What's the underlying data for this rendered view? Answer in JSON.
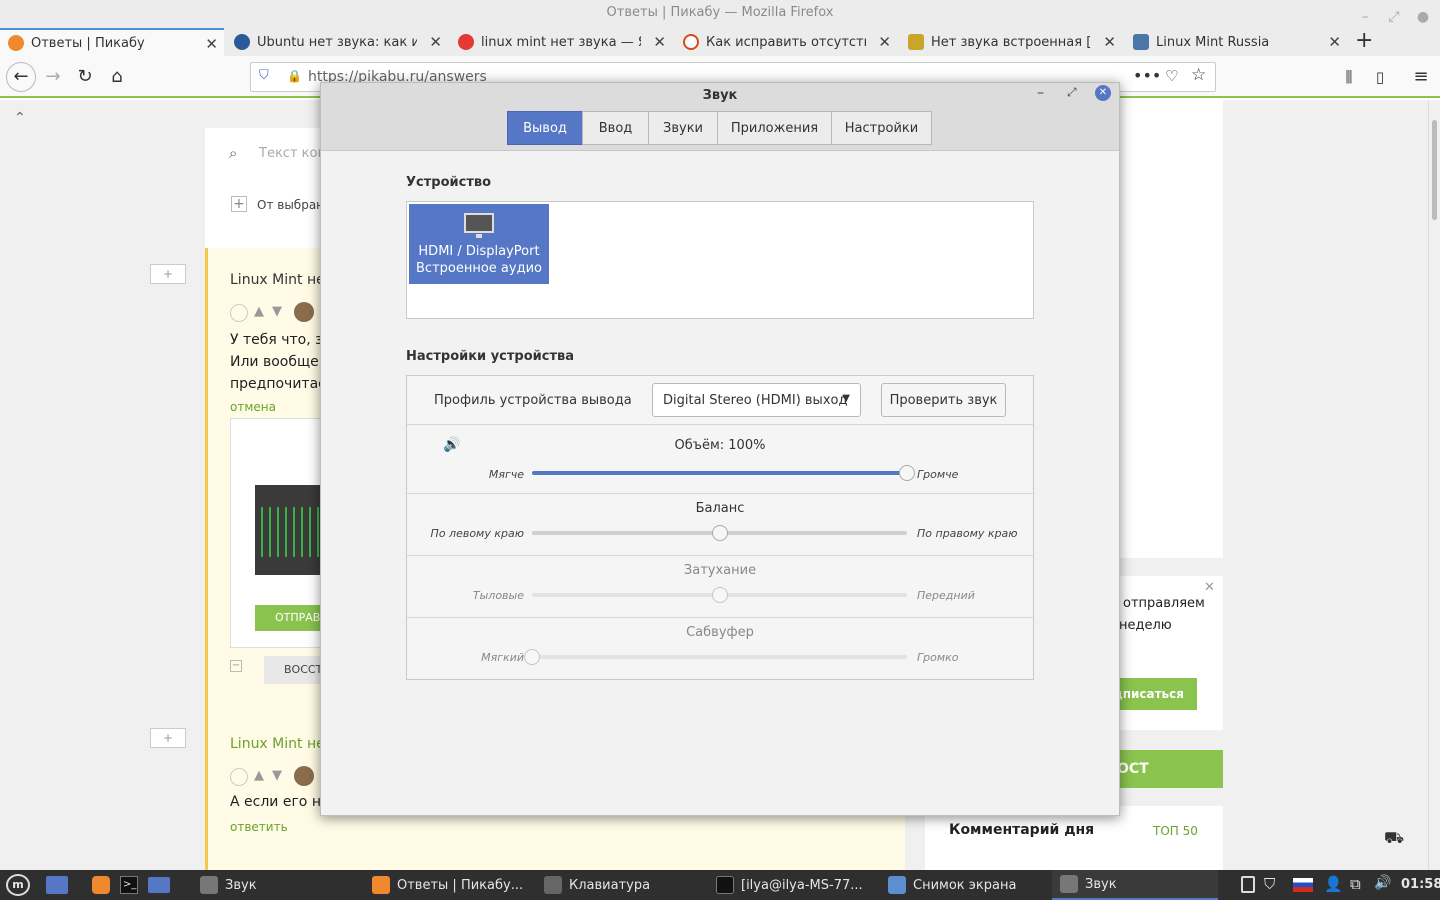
{
  "firefox": {
    "window_title": "Ответы | Пикабу — Mozilla Firefox",
    "tabs": [
      {
        "label": "Ответы | Пикабу",
        "icon": "pikabu-favicon",
        "active": true
      },
      {
        "label": "Ubuntu нет звука: как испр",
        "icon": "wordpress-favicon"
      },
      {
        "label": "linux mint нет звука — Янд",
        "icon": "yandex-favicon"
      },
      {
        "label": "Как исправить отсутствие",
        "icon": "ubuntu-favicon"
      },
      {
        "label": "Нет звука встроенная [AM",
        "icon": "forum-favicon"
      },
      {
        "label": "Linux Mint Russia",
        "icon": "vk-favicon"
      }
    ],
    "url": "https://pikabu.ru/answers"
  },
  "pikabu": {
    "search_placeholder": "Текст ком",
    "from_selected": "От выбран",
    "comment1_title": "Linux Mint нет",
    "comment1_lines": [
      "У тебя что, зву",
      "Или вообще, А",
      "предпочитаем"
    ],
    "cancel": "отмена",
    "send_button": "ОТПРАВ",
    "restore_button": "ВОССТ",
    "comment2_title": "Linux Mint нет",
    "comment2_text": "А если его нет",
    "reply": "ответить",
    "promo_lines": [
      "отправляем",
      "неделю"
    ],
    "subscribe": "дписаться",
    "post_button": "ОСТ",
    "comment_of_day": "Комментарий дня",
    "top50": "ТОП 50"
  },
  "sound": {
    "title": "Звук",
    "tabs": [
      "Вывод",
      "Ввод",
      "Звуки",
      "Приложения",
      "Настройки"
    ],
    "selected_tab": "Вывод",
    "device_section": "Устройство",
    "device_line1": "HDMI / DisplayPort",
    "device_line2": "Встроенное аудио",
    "settings_section": "Настройки устройства",
    "profile_label": "Профиль устройства вывода",
    "profile_value": "Digital Stereo (HDMI) выход",
    "test_button": "Проверить звук",
    "volume_label": "Объём: 100%",
    "volume_level": 1.0,
    "volume_left": "Мягче",
    "volume_right": "Громче",
    "balance_label": "Баланс",
    "balance_level": 0.5,
    "balance_left": "По левому краю",
    "balance_right": "По правому краю",
    "fade_label": "Затухание",
    "fade_level": 0.5,
    "fade_left": "Тыловые",
    "fade_right": "Передний",
    "sub_label": "Сабвуфер",
    "sub_level": 0.0,
    "sub_left": "Мягкий",
    "sub_right": "Громко",
    "accent": "#5677c5"
  },
  "taskbar": {
    "items": [
      "Звук",
      "Ответы | Пикабу...",
      "Клавиатура",
      "[ilya@ilya-MS-77...",
      "Снимок экрана",
      "Звук"
    ],
    "clock": "01:58"
  }
}
